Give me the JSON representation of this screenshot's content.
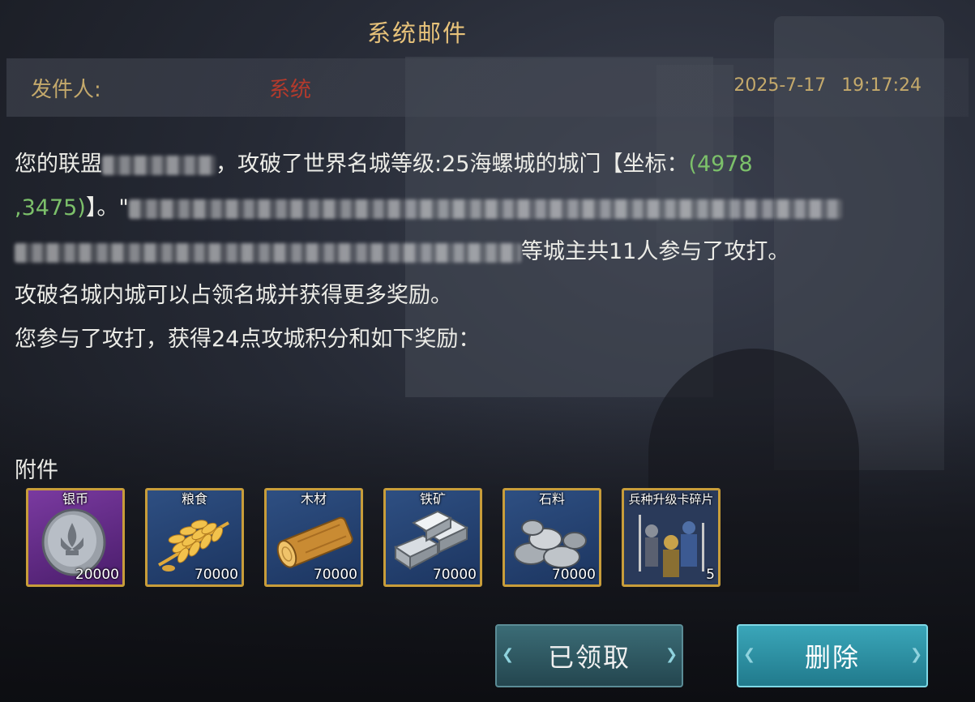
{
  "window": {
    "title": "系统邮件"
  },
  "header": {
    "sender_label": "发件人:",
    "sender_name": "系统",
    "date": "2025-7-17",
    "time": "19:17:24"
  },
  "body": {
    "line1_prefix": "您的联盟",
    "line1_mid": "，攻破了世界名城等级:25海螺城的城门【坐标：",
    "coord_part1": "(4978",
    "coord_part2": ",3475)",
    "line2_suffix": "】。\"",
    "line3_suffix": "等城主共11人参与了攻打。",
    "line4": "攻破名城内城可以占领名城并获得更多奖励。",
    "line5": "您参与了攻打，获得24点攻城积分和如下奖励："
  },
  "attachments": {
    "label": "附件",
    "items": [
      {
        "name": "银币",
        "qty": "20000",
        "icon": "silver-coin-icon"
      },
      {
        "name": "粮食",
        "qty": "70000",
        "icon": "wheat-icon"
      },
      {
        "name": "木材",
        "qty": "70000",
        "icon": "wood-log-icon"
      },
      {
        "name": "铁矿",
        "qty": "70000",
        "icon": "iron-ingot-icon"
      },
      {
        "name": "石料",
        "qty": "70000",
        "icon": "stone-icon"
      },
      {
        "name": "兵种升级卡碎片",
        "qty": "5",
        "icon": "soldier-card-icon"
      }
    ]
  },
  "buttons": {
    "claimed": "已领取",
    "delete": "删除"
  },
  "colors": {
    "title": "#e7c27a",
    "sender_name": "#b43a2c",
    "coordinate": "#7cc06a",
    "item_frame": "#c89d3a"
  }
}
